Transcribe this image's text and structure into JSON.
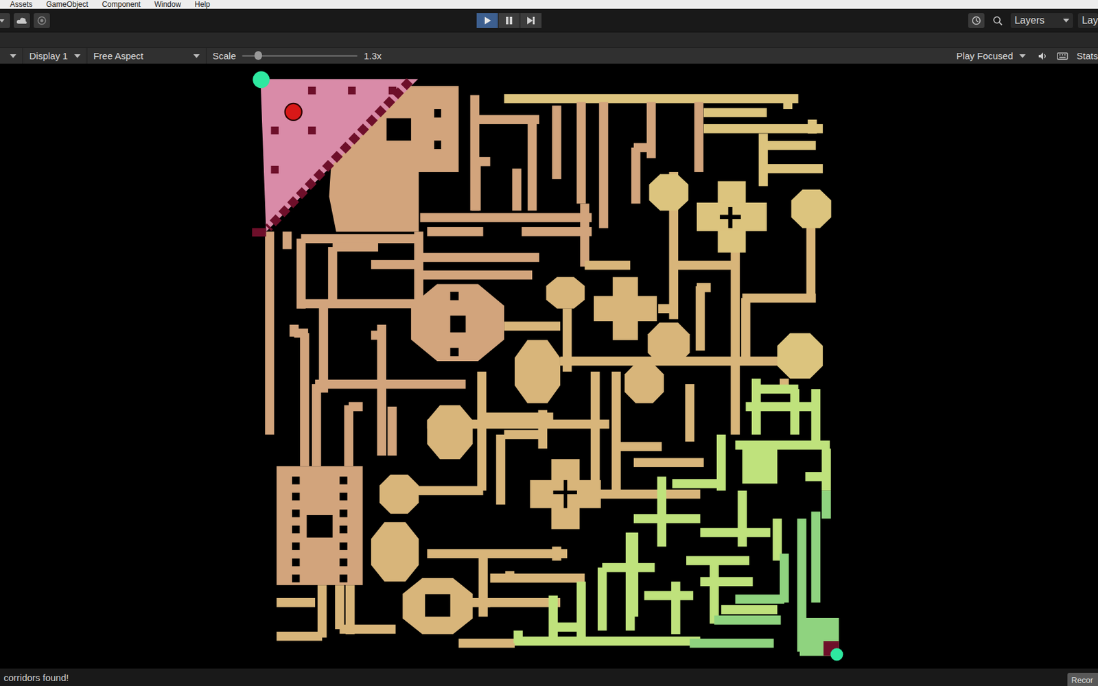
{
  "menu": [
    {
      "label": "Assets"
    },
    {
      "label": "GameObject"
    },
    {
      "label": "Component"
    },
    {
      "label": "Window"
    },
    {
      "label": "Help"
    }
  ],
  "toolbar": {
    "play": {
      "selected": true
    },
    "pause": {
      "selected": false
    },
    "step": {
      "selected": false
    },
    "layers": "Layers",
    "layout": "Lay"
  },
  "game_bar": {
    "display": "Display 1",
    "aspect": "Free Aspect",
    "scale_label": "Scale",
    "scale_level": 0.14,
    "scale_value": "1.3x",
    "focus": "Play Focused",
    "stats": "Stats"
  },
  "status_bar": {
    "message": "corridors found!",
    "badge": "Recor"
  }
}
